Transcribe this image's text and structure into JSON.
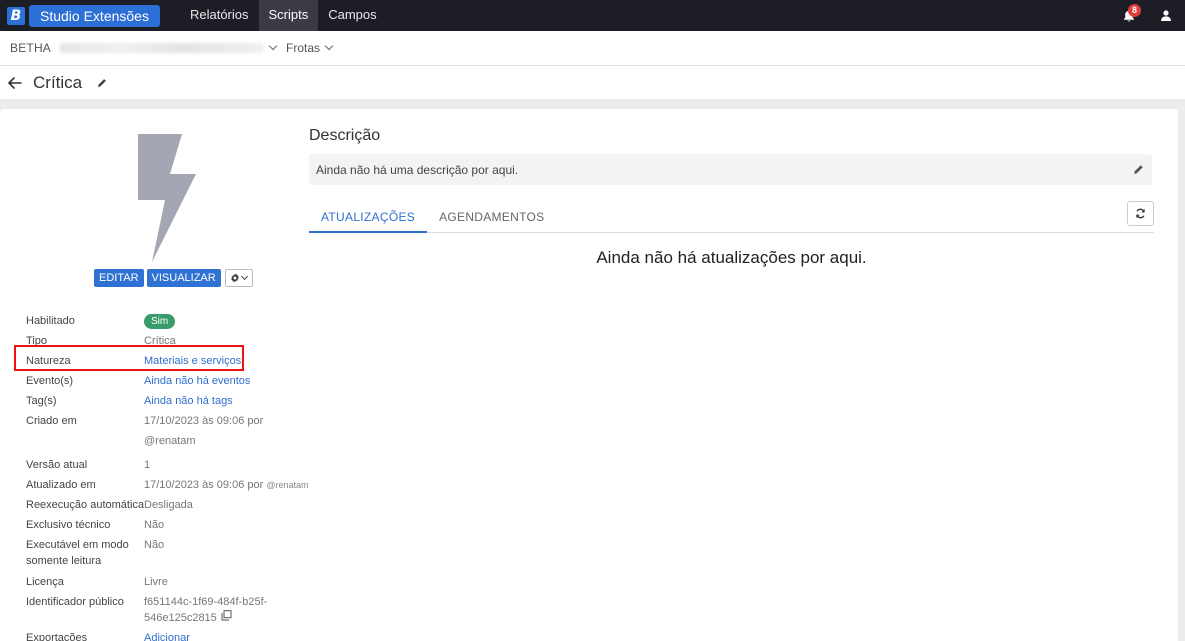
{
  "topbar": {
    "logo_letter": "B",
    "brand": "Studio Extensões",
    "nav": [
      "Relatórios",
      "Scripts",
      "Campos"
    ],
    "active_nav": 1,
    "notifications_count": "8"
  },
  "context": {
    "org": "BETHA",
    "module": "Frotas"
  },
  "page": {
    "title": "Crítica"
  },
  "actions": {
    "edit": "EDITAR",
    "view": "VISUALIZAR"
  },
  "properties": {
    "habilitado": {
      "label": "Habilitado",
      "value": "Sim"
    },
    "tipo": {
      "label": "Tipo",
      "value": "Crítica"
    },
    "natureza": {
      "label": "Natureza",
      "value": "Materiais e serviços"
    },
    "eventos": {
      "label": "Evento(s)",
      "value": "Ainda não há eventos"
    },
    "tags": {
      "label": "Tag(s)",
      "value": "Ainda não há tags"
    },
    "criado": {
      "label": "Criado em",
      "value": "17/10/2023 às 09:06 por",
      "user": "@renatam"
    },
    "versao": {
      "label": "Versão atual",
      "value": "1"
    },
    "atualizado": {
      "label": "Atualizado em",
      "value": "17/10/2023 às 09:06 por",
      "user": "@renatam"
    },
    "reexecucao": {
      "label": "Reexecução automática",
      "value": "Desligada"
    },
    "exclusivo": {
      "label": "Exclusivo técnico",
      "value": "Não"
    },
    "executavel": {
      "label_line1": "Executável em modo",
      "label_line2": "somente leitura",
      "value": "Não"
    },
    "licenca": {
      "label": "Licença",
      "value": "Livre"
    },
    "identificador": {
      "label": "Identificador público",
      "value_line1": "f651144c-1f69-484f-b25f-",
      "value_line2": "546e125c2815"
    },
    "exportacoes": {
      "label": "Exportações",
      "value": "Adicionar"
    }
  },
  "description": {
    "heading": "Descrição",
    "text": "Ainda não há uma descrição por aqui."
  },
  "tabs": [
    "ATUALIZAÇÕES",
    "AGENDAMENTOS"
  ],
  "active_tab": 0,
  "empty_message": "Ainda não há atualizações por aqui.",
  "colors": {
    "topbar": "#1d1d26",
    "primary": "#2f72d3",
    "success": "#3a9b6a",
    "highlight": "#ee1111"
  }
}
